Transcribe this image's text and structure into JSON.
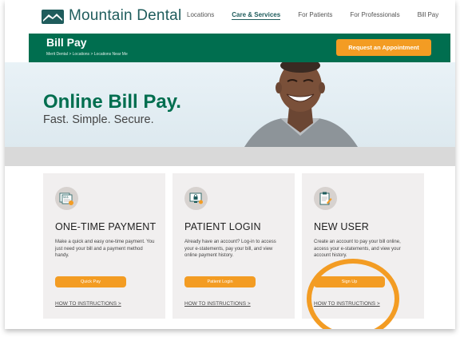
{
  "header": {
    "brand": "Mountain Dental",
    "nav": [
      "Locations",
      "Care & Services",
      "For Patients",
      "For Professionals",
      "Bill Pay"
    ],
    "active_nav": "Care & Services"
  },
  "banner": {
    "title": "Bill Pay",
    "breadcrumb": "Merit Dental > Locations > Locations Near Me",
    "cta": "Request an Appointment"
  },
  "hero": {
    "headline": "Online Bill Pay.",
    "subhead": "Fast. Simple. Secure."
  },
  "cards": [
    {
      "title": "ONE-TIME PAYMENT",
      "body": "Make a quick and easy one-time payment. You just need your bill and a payment method handy.",
      "button": "Quick Pay",
      "link": "HOW TO INSTRUCTIONS >",
      "icon": "bills-icon"
    },
    {
      "title": "PATIENT LOGIN",
      "body": "Already have an account? Log-in to access your e-statements, pay your bill, and view online payment history.",
      "button": "Patient Login",
      "link": "HOW TO INSTRUCTIONS >",
      "icon": "secure-monitor-icon"
    },
    {
      "title": "NEW USER",
      "body": "Create an account to pay your bill online, access your e-statements, and view your account history.",
      "button": "Sign Up",
      "link": "HOW TO INSTRUCTIONS >",
      "icon": "clipboard-icon"
    }
  ],
  "colors": {
    "brand_green": "#006e4f",
    "accent_orange": "#f39c23",
    "teal_text": "#1f5c5c"
  }
}
